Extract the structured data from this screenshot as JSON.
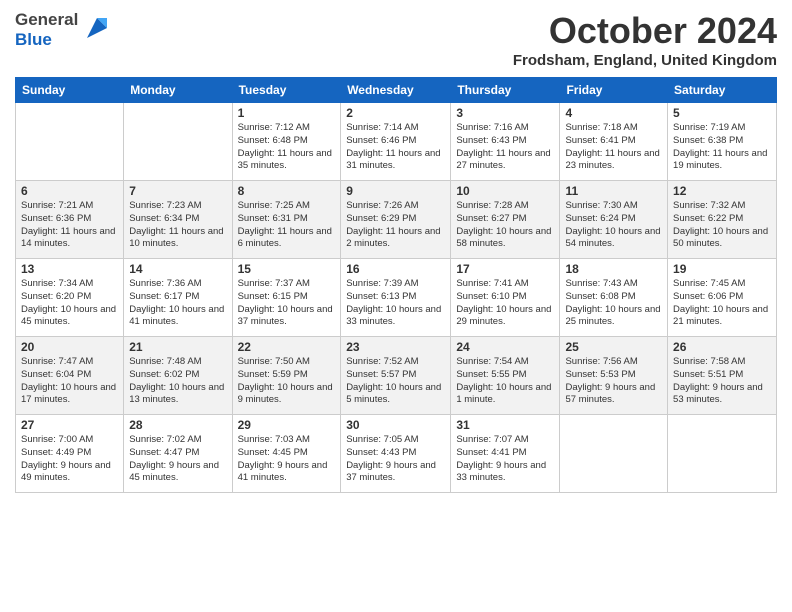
{
  "header": {
    "logo_line1": "General",
    "logo_line2": "Blue",
    "month_title": "October 2024",
    "location": "Frodsham, England, United Kingdom"
  },
  "weekdays": [
    "Sunday",
    "Monday",
    "Tuesday",
    "Wednesday",
    "Thursday",
    "Friday",
    "Saturday"
  ],
  "rows": [
    [
      {
        "day": "",
        "info": ""
      },
      {
        "day": "",
        "info": ""
      },
      {
        "day": "1",
        "info": "Sunrise: 7:12 AM\nSunset: 6:48 PM\nDaylight: 11 hours and 35 minutes."
      },
      {
        "day": "2",
        "info": "Sunrise: 7:14 AM\nSunset: 6:46 PM\nDaylight: 11 hours and 31 minutes."
      },
      {
        "day": "3",
        "info": "Sunrise: 7:16 AM\nSunset: 6:43 PM\nDaylight: 11 hours and 27 minutes."
      },
      {
        "day": "4",
        "info": "Sunrise: 7:18 AM\nSunset: 6:41 PM\nDaylight: 11 hours and 23 minutes."
      },
      {
        "day": "5",
        "info": "Sunrise: 7:19 AM\nSunset: 6:38 PM\nDaylight: 11 hours and 19 minutes."
      }
    ],
    [
      {
        "day": "6",
        "info": "Sunrise: 7:21 AM\nSunset: 6:36 PM\nDaylight: 11 hours and 14 minutes."
      },
      {
        "day": "7",
        "info": "Sunrise: 7:23 AM\nSunset: 6:34 PM\nDaylight: 11 hours and 10 minutes."
      },
      {
        "day": "8",
        "info": "Sunrise: 7:25 AM\nSunset: 6:31 PM\nDaylight: 11 hours and 6 minutes."
      },
      {
        "day": "9",
        "info": "Sunrise: 7:26 AM\nSunset: 6:29 PM\nDaylight: 11 hours and 2 minutes."
      },
      {
        "day": "10",
        "info": "Sunrise: 7:28 AM\nSunset: 6:27 PM\nDaylight: 10 hours and 58 minutes."
      },
      {
        "day": "11",
        "info": "Sunrise: 7:30 AM\nSunset: 6:24 PM\nDaylight: 10 hours and 54 minutes."
      },
      {
        "day": "12",
        "info": "Sunrise: 7:32 AM\nSunset: 6:22 PM\nDaylight: 10 hours and 50 minutes."
      }
    ],
    [
      {
        "day": "13",
        "info": "Sunrise: 7:34 AM\nSunset: 6:20 PM\nDaylight: 10 hours and 45 minutes."
      },
      {
        "day": "14",
        "info": "Sunrise: 7:36 AM\nSunset: 6:17 PM\nDaylight: 10 hours and 41 minutes."
      },
      {
        "day": "15",
        "info": "Sunrise: 7:37 AM\nSunset: 6:15 PM\nDaylight: 10 hours and 37 minutes."
      },
      {
        "day": "16",
        "info": "Sunrise: 7:39 AM\nSunset: 6:13 PM\nDaylight: 10 hours and 33 minutes."
      },
      {
        "day": "17",
        "info": "Sunrise: 7:41 AM\nSunset: 6:10 PM\nDaylight: 10 hours and 29 minutes."
      },
      {
        "day": "18",
        "info": "Sunrise: 7:43 AM\nSunset: 6:08 PM\nDaylight: 10 hours and 25 minutes."
      },
      {
        "day": "19",
        "info": "Sunrise: 7:45 AM\nSunset: 6:06 PM\nDaylight: 10 hours and 21 minutes."
      }
    ],
    [
      {
        "day": "20",
        "info": "Sunrise: 7:47 AM\nSunset: 6:04 PM\nDaylight: 10 hours and 17 minutes."
      },
      {
        "day": "21",
        "info": "Sunrise: 7:48 AM\nSunset: 6:02 PM\nDaylight: 10 hours and 13 minutes."
      },
      {
        "day": "22",
        "info": "Sunrise: 7:50 AM\nSunset: 5:59 PM\nDaylight: 10 hours and 9 minutes."
      },
      {
        "day": "23",
        "info": "Sunrise: 7:52 AM\nSunset: 5:57 PM\nDaylight: 10 hours and 5 minutes."
      },
      {
        "day": "24",
        "info": "Sunrise: 7:54 AM\nSunset: 5:55 PM\nDaylight: 10 hours and 1 minute."
      },
      {
        "day": "25",
        "info": "Sunrise: 7:56 AM\nSunset: 5:53 PM\nDaylight: 9 hours and 57 minutes."
      },
      {
        "day": "26",
        "info": "Sunrise: 7:58 AM\nSunset: 5:51 PM\nDaylight: 9 hours and 53 minutes."
      }
    ],
    [
      {
        "day": "27",
        "info": "Sunrise: 7:00 AM\nSunset: 4:49 PM\nDaylight: 9 hours and 49 minutes."
      },
      {
        "day": "28",
        "info": "Sunrise: 7:02 AM\nSunset: 4:47 PM\nDaylight: 9 hours and 45 minutes."
      },
      {
        "day": "29",
        "info": "Sunrise: 7:03 AM\nSunset: 4:45 PM\nDaylight: 9 hours and 41 minutes."
      },
      {
        "day": "30",
        "info": "Sunrise: 7:05 AM\nSunset: 4:43 PM\nDaylight: 9 hours and 37 minutes."
      },
      {
        "day": "31",
        "info": "Sunrise: 7:07 AM\nSunset: 4:41 PM\nDaylight: 9 hours and 33 minutes."
      },
      {
        "day": "",
        "info": ""
      },
      {
        "day": "",
        "info": ""
      }
    ]
  ]
}
